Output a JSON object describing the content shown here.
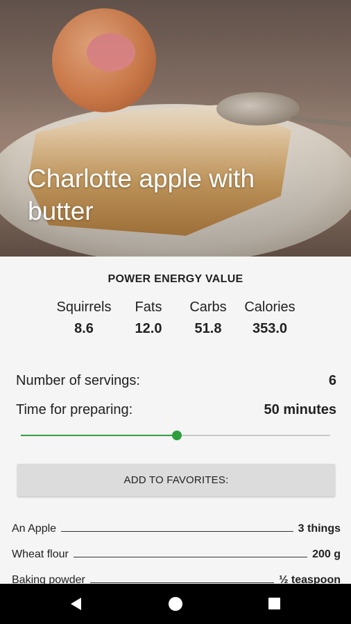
{
  "recipe": {
    "title": "Charlotte apple with butter"
  },
  "energy": {
    "heading": "POWER ENERGY VALUE",
    "items": [
      {
        "label": "Squirrels",
        "value": "8.6"
      },
      {
        "label": "Fats",
        "value": "12.0"
      },
      {
        "label": "Carbs",
        "value": "51.8"
      },
      {
        "label": "Calories",
        "value": "353.0"
      }
    ]
  },
  "details": {
    "servings_label": "Number of servings:",
    "servings_value": "6",
    "time_label": "Time for preparing:",
    "time_value": "50 minutes"
  },
  "slider": {
    "level": 0.505,
    "color": "#2e9e3e"
  },
  "favorites_button": "ADD TO FAVORITES:",
  "ingredients": [
    {
      "name": "An Apple",
      "qty": "3 things"
    },
    {
      "name": "Wheat flour",
      "qty": "200 g"
    },
    {
      "name": "Baking powder",
      "qty": "½ teaspoon"
    }
  ],
  "navbar": {
    "icons": [
      "back-icon",
      "home-icon",
      "recent-apps-icon"
    ]
  }
}
